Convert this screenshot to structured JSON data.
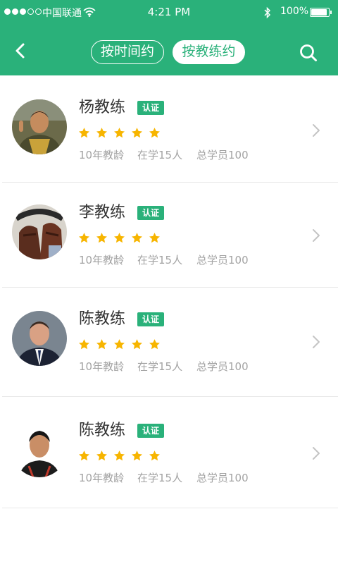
{
  "status_bar": {
    "carrier": "中国联通",
    "time": "4:21 PM",
    "battery": "100%",
    "battery_level": 0.9
  },
  "nav": {
    "segments": [
      "按时间约",
      "按教练约"
    ],
    "active_segment": "按教练约",
    "icons": {
      "back": "chevron-left-icon",
      "search": "search-icon"
    }
  },
  "coaches": [
    {
      "name": "杨教练",
      "badge": "认证",
      "rating": 5,
      "experience": "10年教龄",
      "current": "在学15人",
      "total": "总学员100"
    },
    {
      "name": "李教练",
      "badge": "认证",
      "rating": 5,
      "experience": "10年教龄",
      "current": "在学15人",
      "total": "总学员100"
    },
    {
      "name": "陈教练",
      "badge": "认证",
      "rating": 5,
      "experience": "10年教龄",
      "current": "在学15人",
      "total": "总学员100"
    },
    {
      "name": "陈教练",
      "badge": "认证",
      "rating": 5,
      "experience": "10年教龄",
      "current": "在学15人",
      "total": "总学员100"
    }
  ],
  "colors": {
    "brand": "#2ab17a",
    "star": "#f7b500",
    "meta_text": "#a3a3a3"
  }
}
